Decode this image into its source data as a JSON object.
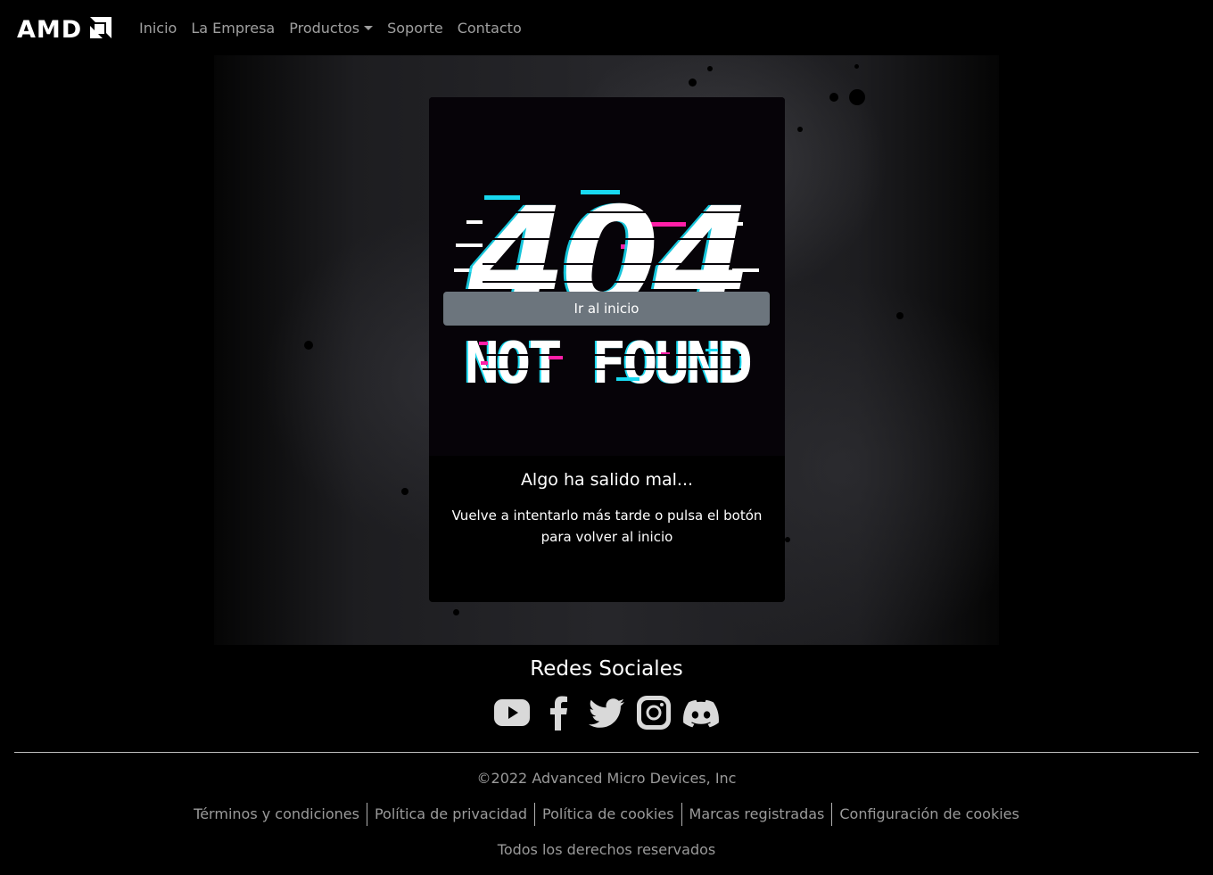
{
  "brand": {
    "logo_text": "AMD"
  },
  "nav": {
    "items": [
      {
        "label": "Inicio"
      },
      {
        "label": "La Empresa"
      },
      {
        "label": "Productos",
        "has_dropdown": true
      },
      {
        "label": "Soporte"
      },
      {
        "label": "Contacto"
      }
    ]
  },
  "error_card": {
    "image_code": "404",
    "image_caption": "NOT FOUND",
    "title": "Algo ha salido mal...",
    "text": "Vuelve a intentarlo más tarde o pulsa el botón para volver al inicio",
    "button_label": "Ir al inicio"
  },
  "social": {
    "title": "Redes Sociales",
    "icons": [
      "youtube-icon",
      "facebook-icon",
      "twitter-icon",
      "instagram-icon",
      "discord-icon"
    ]
  },
  "footer": {
    "copyright": "©2022 Advanced Micro Devices, Inc",
    "links": [
      {
        "label": "Términos y condiciones"
      },
      {
        "label": "Política de privacidad"
      },
      {
        "label": "Política de cookies"
      },
      {
        "label": "Marcas registradas"
      },
      {
        "label": "Configuración de cookies"
      }
    ],
    "rights": "Todos los derechos reservados"
  },
  "colors": {
    "background": "#000000",
    "button": "#6c757d",
    "glitch_cyan": "#18d9f0",
    "glitch_magenta": "#ff1fa8",
    "muted_text": "#9a9a9a"
  }
}
